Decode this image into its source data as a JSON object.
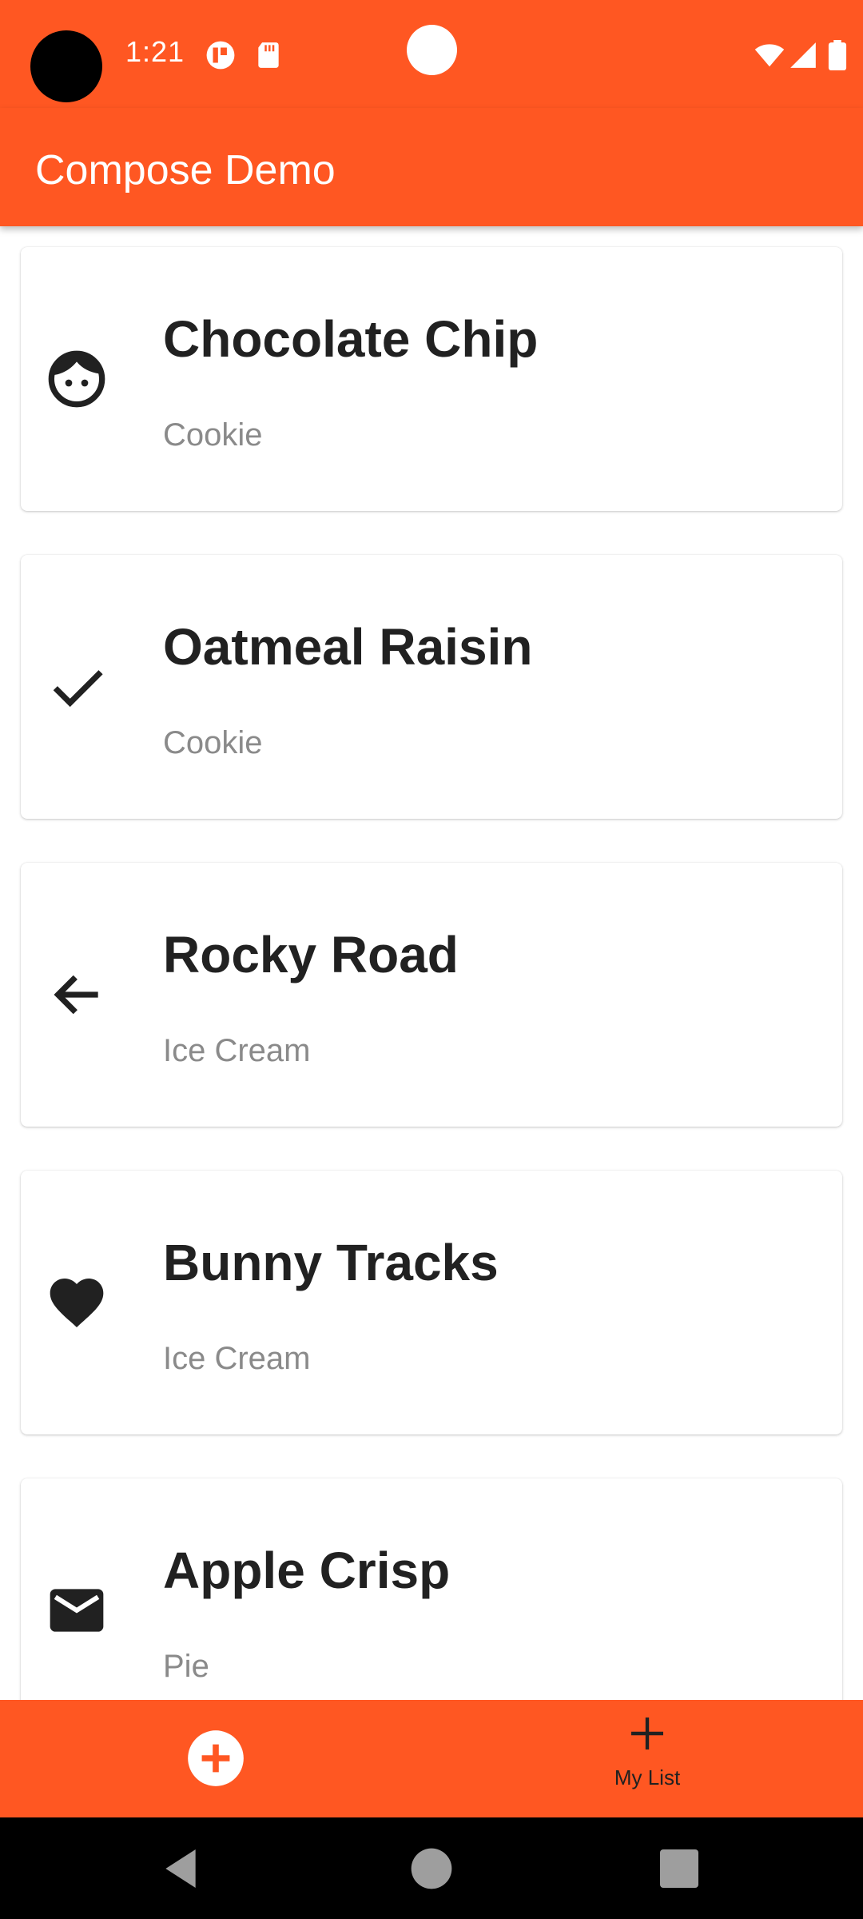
{
  "status_bar": {
    "time": "1:21",
    "icons": [
      "camera-cutout",
      "t-notification-icon",
      "sd-card-icon",
      "wifi-icon",
      "signal-icon",
      "battery-icon"
    ]
  },
  "app_bar": {
    "title": "Compose Demo"
  },
  "items": [
    {
      "title": "Chocolate Chip",
      "subtitle": "Cookie",
      "icon": "face-icon"
    },
    {
      "title": "Oatmeal Raisin",
      "subtitle": "Cookie",
      "icon": "check-icon"
    },
    {
      "title": "Rocky Road",
      "subtitle": "Ice Cream",
      "icon": "arrow-back-icon"
    },
    {
      "title": "Bunny Tracks",
      "subtitle": "Ice Cream",
      "icon": "heart-icon"
    },
    {
      "title": "Apple Crisp",
      "subtitle": "Pie",
      "icon": "mail-icon"
    }
  ],
  "bottom_bar": {
    "add_icon": "add-circle-icon",
    "my_list_label": "My List",
    "my_list_icon": "plus-icon"
  },
  "system_nav": {
    "buttons": [
      "back-icon",
      "home-icon",
      "recents-icon"
    ]
  },
  "colors": {
    "primary": "#FF5722",
    "title_text": "#212121",
    "subtitle_text": "#8a8a8a",
    "on_primary": "#FFFFFF"
  }
}
